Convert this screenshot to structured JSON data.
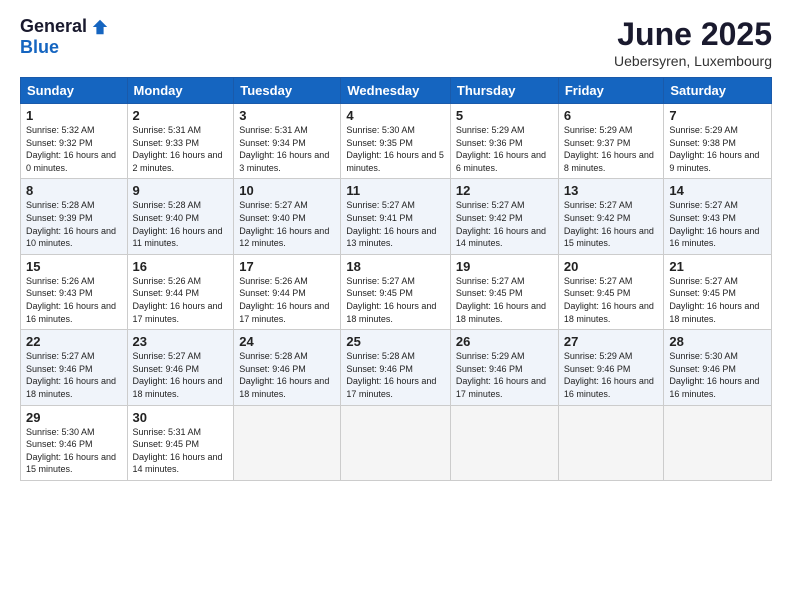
{
  "logo": {
    "general": "General",
    "blue": "Blue"
  },
  "title": "June 2025",
  "subtitle": "Uebersyren, Luxembourg",
  "days": [
    "Sunday",
    "Monday",
    "Tuesday",
    "Wednesday",
    "Thursday",
    "Friday",
    "Saturday"
  ],
  "weeks": [
    [
      {
        "day": "1",
        "sunrise": "5:32 AM",
        "sunset": "9:32 PM",
        "daylight": "16 hours and 0 minutes."
      },
      {
        "day": "2",
        "sunrise": "5:31 AM",
        "sunset": "9:33 PM",
        "daylight": "16 hours and 2 minutes."
      },
      {
        "day": "3",
        "sunrise": "5:31 AM",
        "sunset": "9:34 PM",
        "daylight": "16 hours and 3 minutes."
      },
      {
        "day": "4",
        "sunrise": "5:30 AM",
        "sunset": "9:35 PM",
        "daylight": "16 hours and 5 minutes."
      },
      {
        "day": "5",
        "sunrise": "5:29 AM",
        "sunset": "9:36 PM",
        "daylight": "16 hours and 6 minutes."
      },
      {
        "day": "6",
        "sunrise": "5:29 AM",
        "sunset": "9:37 PM",
        "daylight": "16 hours and 8 minutes."
      },
      {
        "day": "7",
        "sunrise": "5:29 AM",
        "sunset": "9:38 PM",
        "daylight": "16 hours and 9 minutes."
      }
    ],
    [
      {
        "day": "8",
        "sunrise": "5:28 AM",
        "sunset": "9:39 PM",
        "daylight": "16 hours and 10 minutes."
      },
      {
        "day": "9",
        "sunrise": "5:28 AM",
        "sunset": "9:40 PM",
        "daylight": "16 hours and 11 minutes."
      },
      {
        "day": "10",
        "sunrise": "5:27 AM",
        "sunset": "9:40 PM",
        "daylight": "16 hours and 12 minutes."
      },
      {
        "day": "11",
        "sunrise": "5:27 AM",
        "sunset": "9:41 PM",
        "daylight": "16 hours and 13 minutes."
      },
      {
        "day": "12",
        "sunrise": "5:27 AM",
        "sunset": "9:42 PM",
        "daylight": "16 hours and 14 minutes."
      },
      {
        "day": "13",
        "sunrise": "5:27 AM",
        "sunset": "9:42 PM",
        "daylight": "16 hours and 15 minutes."
      },
      {
        "day": "14",
        "sunrise": "5:27 AM",
        "sunset": "9:43 PM",
        "daylight": "16 hours and 16 minutes."
      }
    ],
    [
      {
        "day": "15",
        "sunrise": "5:26 AM",
        "sunset": "9:43 PM",
        "daylight": "16 hours and 16 minutes."
      },
      {
        "day": "16",
        "sunrise": "5:26 AM",
        "sunset": "9:44 PM",
        "daylight": "16 hours and 17 minutes."
      },
      {
        "day": "17",
        "sunrise": "5:26 AM",
        "sunset": "9:44 PM",
        "daylight": "16 hours and 17 minutes."
      },
      {
        "day": "18",
        "sunrise": "5:27 AM",
        "sunset": "9:45 PM",
        "daylight": "16 hours and 18 minutes."
      },
      {
        "day": "19",
        "sunrise": "5:27 AM",
        "sunset": "9:45 PM",
        "daylight": "16 hours and 18 minutes."
      },
      {
        "day": "20",
        "sunrise": "5:27 AM",
        "sunset": "9:45 PM",
        "daylight": "16 hours and 18 minutes."
      },
      {
        "day": "21",
        "sunrise": "5:27 AM",
        "sunset": "9:45 PM",
        "daylight": "16 hours and 18 minutes."
      }
    ],
    [
      {
        "day": "22",
        "sunrise": "5:27 AM",
        "sunset": "9:46 PM",
        "daylight": "16 hours and 18 minutes."
      },
      {
        "day": "23",
        "sunrise": "5:27 AM",
        "sunset": "9:46 PM",
        "daylight": "16 hours and 18 minutes."
      },
      {
        "day": "24",
        "sunrise": "5:28 AM",
        "sunset": "9:46 PM",
        "daylight": "16 hours and 18 minutes."
      },
      {
        "day": "25",
        "sunrise": "5:28 AM",
        "sunset": "9:46 PM",
        "daylight": "16 hours and 17 minutes."
      },
      {
        "day": "26",
        "sunrise": "5:29 AM",
        "sunset": "9:46 PM",
        "daylight": "16 hours and 17 minutes."
      },
      {
        "day": "27",
        "sunrise": "5:29 AM",
        "sunset": "9:46 PM",
        "daylight": "16 hours and 16 minutes."
      },
      {
        "day": "28",
        "sunrise": "5:30 AM",
        "sunset": "9:46 PM",
        "daylight": "16 hours and 16 minutes."
      }
    ],
    [
      {
        "day": "29",
        "sunrise": "5:30 AM",
        "sunset": "9:46 PM",
        "daylight": "16 hours and 15 minutes."
      },
      {
        "day": "30",
        "sunrise": "5:31 AM",
        "sunset": "9:45 PM",
        "daylight": "16 hours and 14 minutes."
      },
      null,
      null,
      null,
      null,
      null
    ]
  ],
  "labels": {
    "sunrise": "Sunrise:",
    "sunset": "Sunset:",
    "daylight": "Daylight:"
  }
}
